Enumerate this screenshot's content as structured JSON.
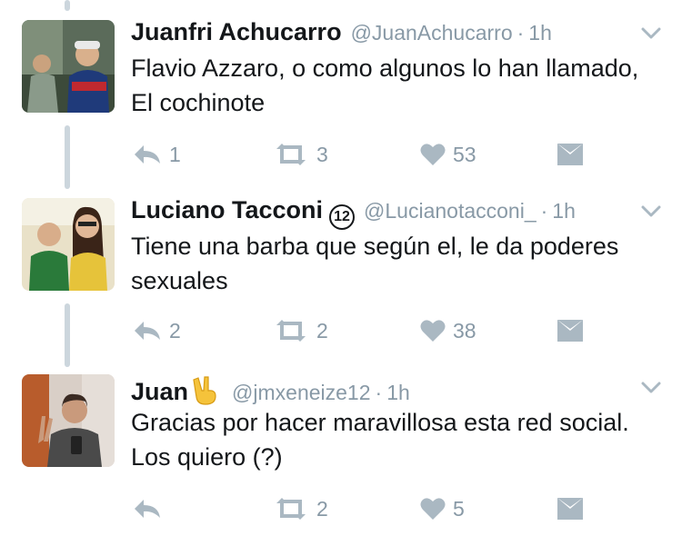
{
  "tweets": [
    {
      "name": "Juanfri Achucarro",
      "badge": "",
      "handle": "@JuanAchucarro",
      "separator": "·",
      "time": "1h",
      "text": "Flavio Azzaro, o como algunos lo han llamado, El cochinote",
      "replies": "1",
      "retweets": "3",
      "likes": "53"
    },
    {
      "name": "Luciano Tacconi",
      "badge": "12",
      "handle": "@Lucianotacconi_",
      "separator": "·",
      "time": "1h",
      "text": "Tiene una barba que según el, le da poderes sexuales",
      "replies": "2",
      "retweets": "2",
      "likes": "38"
    },
    {
      "name": "Juan",
      "badge": "",
      "handle": "@jmxeneize12",
      "separator": "·",
      "time": "1h",
      "text": "Gracias por hacer maravillosa esta red social. Los quiero (?)",
      "replies": "",
      "retweets": "2",
      "likes": "5"
    }
  ],
  "icons": {
    "reply": "reply-icon",
    "retweet": "retweet-icon",
    "like": "heart-icon",
    "message": "envelope-icon",
    "more": "chevron-down-icon",
    "emoji": "victory-hand-icon"
  },
  "colors": {
    "icon_gray": "#aab8c2",
    "meta_gray": "#8899a6",
    "thread_line": "#ccd6dd"
  }
}
